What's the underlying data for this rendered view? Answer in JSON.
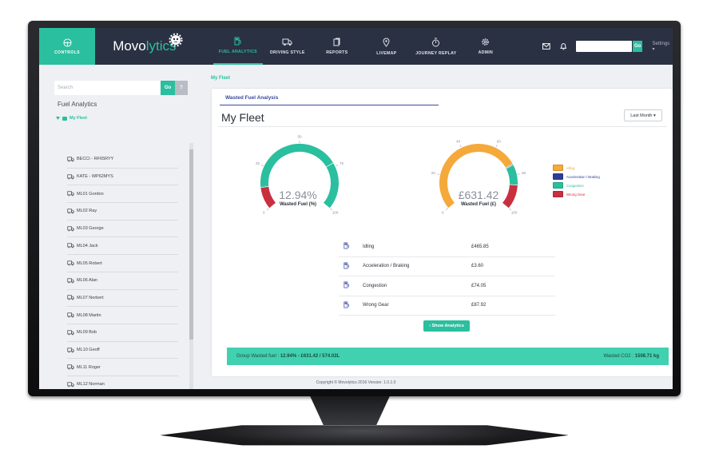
{
  "header": {
    "controls_label": "CONTROLS",
    "logo_primary": "Movo",
    "logo_accent": "lytics",
    "nav": [
      {
        "label": "FUEL ANALYTICS",
        "icon": "fuel-pump-icon"
      },
      {
        "label": "DRIVING STYLE",
        "icon": "truck-icon"
      },
      {
        "label": "REPORTS",
        "icon": "document-icon"
      },
      {
        "label": "LIVEMAP",
        "icon": "map-pin-icon"
      },
      {
        "label": "JOURNEY REPLAY",
        "icon": "stopwatch-icon"
      },
      {
        "label": "ADMIN",
        "icon": "gear-icon"
      }
    ],
    "go_label": "Go",
    "settings_label": "Settings ▾"
  },
  "sidebar": {
    "search_placeholder": "Search",
    "go_label": "Go",
    "help_label": "?",
    "title": "Fuel Analytics",
    "root_label": "My Fleet",
    "vehicles": [
      "BECCI - RF65RYY",
      "KATE - WP62MYS",
      "ML01 Gordon",
      "ML02 Ray",
      "ML03 George",
      "ML04 Jack",
      "ML05 Robert",
      "ML06 Alan",
      "ML07 Norbert",
      "ML08 Martin",
      "ML09 Bob",
      "ML10 Geoff",
      "ML11 Roger",
      "ML12 Norman"
    ]
  },
  "main": {
    "breadcrumb": "My Fleet",
    "tab_label": "Wasted Fuel Analysis",
    "title": "My Fleet",
    "period_dropdown": "Last Month ▾",
    "gauge_percent": {
      "value_text": "12.94%",
      "label": "Wasted Fuel (%)",
      "ticks": [
        "0",
        "25",
        "50",
        "75",
        "100"
      ],
      "segments": [
        {
          "from": 0,
          "to": 12.94,
          "color": "#c9303f"
        },
        {
          "from": 12.94,
          "to": 73,
          "color": "#2abf9e"
        },
        {
          "from": 73,
          "to": 100,
          "color": "#2abf9e"
        }
      ]
    },
    "gauge_cost": {
      "value_text": "£631.42",
      "label": "Wasted Fuel (£)",
      "ticks": [
        "0",
        "20",
        "40",
        "60",
        "80",
        "100"
      ],
      "segments": [
        {
          "from": 0,
          "to": 73.7,
          "color": "#f5a93a"
        },
        {
          "from": 73.7,
          "to": 74.3,
          "color": "#2e3d9a"
        },
        {
          "from": 74.3,
          "to": 86.1,
          "color": "#2abf9e"
        },
        {
          "from": 86.1,
          "to": 100,
          "color": "#c9303f"
        }
      ]
    },
    "legend": [
      {
        "label": "Idling",
        "color": "#f5a93a"
      },
      {
        "label": "Acceleration / Braking",
        "color": "#2e3d9a"
      },
      {
        "label": "Congestion",
        "color": "#2abf9e"
      },
      {
        "label": "Wrong Gear",
        "color": "#c9303f"
      }
    ],
    "breakdown": [
      {
        "name": "Idling",
        "value": "£465.85"
      },
      {
        "name": "Acceleration / Braking",
        "value": "£3.60"
      },
      {
        "name": "Congestion",
        "value": "£74.05"
      },
      {
        "name": "Wrong Gear",
        "value": "£87.92"
      }
    ],
    "show_analytics_label": "› Show Analytics",
    "group_wasted_fuel_label": "Group Wasted fuel : ",
    "group_wasted_fuel_value": "12.94% - £631.42 / 574.02L",
    "wasted_co2_label": "Wasted CO2 : ",
    "wasted_co2_value": "1508.71 kg",
    "copyright": "Copyright © Movolytics 2016 Version: 1.0.1.0"
  }
}
